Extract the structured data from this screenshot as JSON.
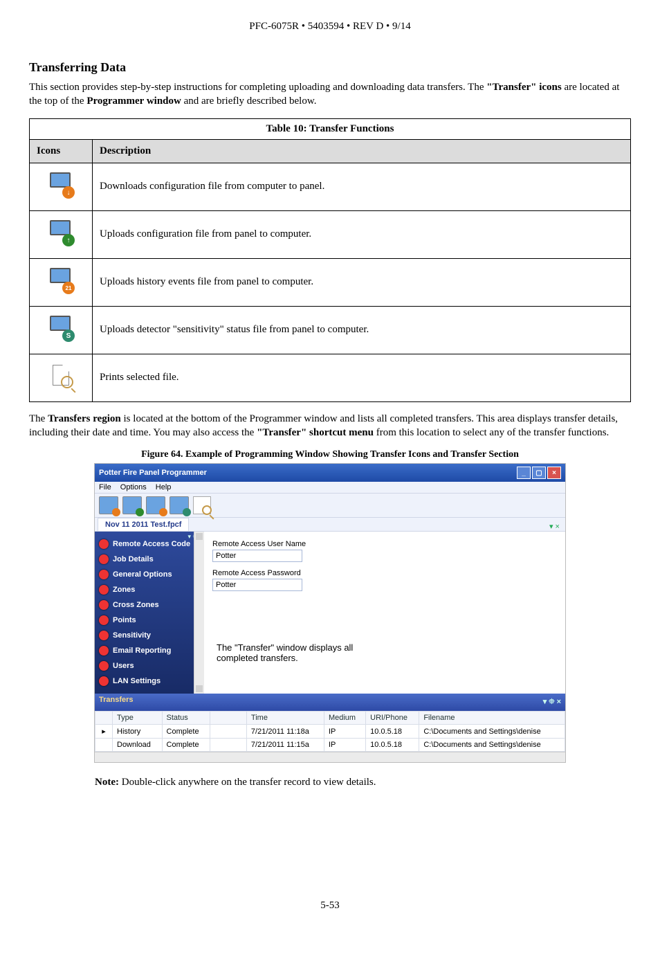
{
  "header": "PFC-6075R • 5403594 • REV D • 9/14",
  "section_title": "Transferring Data",
  "intro_part1": "This section provides step-by-step instructions for completing uploading and downloading data transfers. The ",
  "intro_bold1": "\"Transfer\" icons",
  "intro_part2": " are located at the top of the ",
  "intro_bold2": "Programmer window",
  "intro_part3": " and are briefly described below.",
  "table10": {
    "caption": "Table 10: Transfer Functions",
    "headers": {
      "icons": "Icons",
      "description": "Description"
    },
    "rows": [
      {
        "icon": "download-icon",
        "desc": "Downloads configuration file from computer to panel."
      },
      {
        "icon": "upload-icon",
        "desc": "Uploads configuration file from panel to computer."
      },
      {
        "icon": "history-icon",
        "desc": "Uploads history events file from panel to computer."
      },
      {
        "icon": "sensitivity-icon",
        "desc": "Uploads detector \"sensitivity\" status file from panel to computer."
      },
      {
        "icon": "print-icon",
        "desc": "Prints selected file."
      }
    ]
  },
  "mid_para": {
    "p1": "The ",
    "b1": "Transfers region",
    "p2": " is located at the bottom of the Programmer window and lists all completed transfers. This area displays transfer details, including their date and time. You may also access the ",
    "b2": "\"Transfer\" shortcut menu",
    "p3": " from this location to select any of the transfer functions."
  },
  "figure_caption": "Figure 64. Example of Programming Window Showing Transfer Icons and Transfer Section",
  "app": {
    "title": "Potter Fire Panel Programmer",
    "menu": [
      "File",
      "Options",
      "Help"
    ],
    "tab": "Nov 11 2011 Test.fpcf",
    "tab_close_hint": "▾ ×",
    "side_controls": "▾ ⯐ ×",
    "sidebar_items": [
      "Remote Access Code",
      "Job Details",
      "General Options",
      "Zones",
      "Cross Zones",
      "Points",
      "Sensitivity",
      "Email Reporting",
      "Users",
      "LAN Settings"
    ],
    "fields": {
      "user_label": "Remote Access User Name",
      "user_value": "Potter",
      "pass_label": "Remote Access Password",
      "pass_value": "Potter"
    },
    "annotation_line1": "The \"Transfer\" window displays all",
    "annotation_line2": "completed transfers.",
    "transfers_title": "Transfers",
    "transfers_ctrls": "▾ ⯐ ×",
    "grid_headers": [
      "",
      "Type",
      "Status",
      "",
      "Time",
      "Medium",
      "URI/Phone",
      "Filename"
    ],
    "grid_rows": [
      [
        "▸",
        "History",
        "Complete",
        "",
        "7/21/2011 11:18a",
        "IP",
        "10.0.5.18",
        "C:\\Documents and Settings\\denise"
      ],
      [
        "",
        "Download",
        "Complete",
        "",
        "7/21/2011 11:15a",
        "IP",
        "10.0.5.18",
        "C:\\Documents and Settings\\denise"
      ]
    ]
  },
  "note_label": "Note:",
  "note_text": " Double-click anywhere on the transfer record to view details.",
  "page_number": "5-53"
}
